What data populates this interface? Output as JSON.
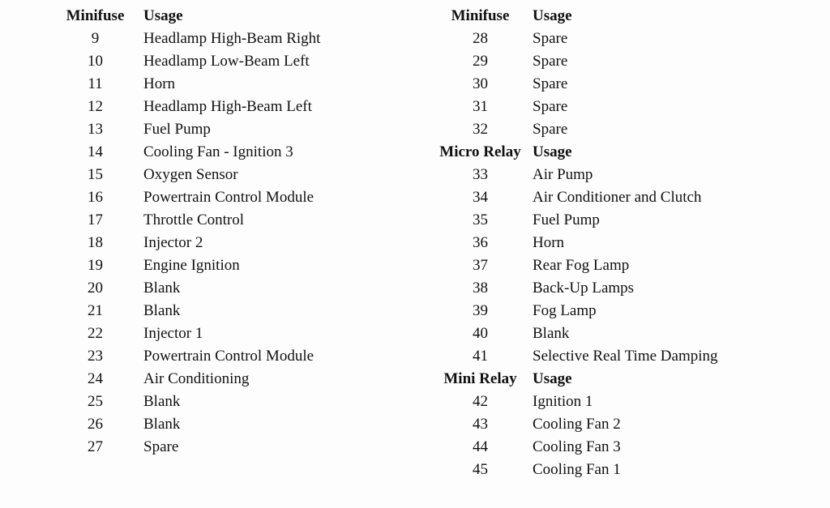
{
  "document": {
    "background_color": "#fdfdfd",
    "text_color": "#111111"
  },
  "columns": [
    {
      "id": "left-column",
      "rows": [
        {
          "type": "header",
          "id": "Minifuse",
          "usage": "Usage"
        },
        {
          "type": "data",
          "id": "9",
          "usage": "Headlamp High-Beam Right"
        },
        {
          "type": "data",
          "id": "10",
          "usage": "Headlamp Low-Beam Left"
        },
        {
          "type": "data",
          "id": "11",
          "usage": "Horn"
        },
        {
          "type": "data",
          "id": "12",
          "usage": "Headlamp High-Beam Left"
        },
        {
          "type": "data",
          "id": "13",
          "usage": "Fuel Pump"
        },
        {
          "type": "data",
          "id": "14",
          "usage": "Cooling Fan - Ignition 3"
        },
        {
          "type": "data",
          "id": "15",
          "usage": "Oxygen Sensor"
        },
        {
          "type": "data",
          "id": "16",
          "usage": "Powertrain Control Module"
        },
        {
          "type": "data",
          "id": "17",
          "usage": "Throttle Control"
        },
        {
          "type": "data",
          "id": "18",
          "usage": "Injector 2"
        },
        {
          "type": "data",
          "id": "19",
          "usage": "Engine Ignition"
        },
        {
          "type": "data",
          "id": "20",
          "usage": "Blank"
        },
        {
          "type": "data",
          "id": "21",
          "usage": "Blank"
        },
        {
          "type": "data",
          "id": "22",
          "usage": "Injector 1"
        },
        {
          "type": "data",
          "id": "23",
          "usage": "Powertrain Control Module"
        },
        {
          "type": "data",
          "id": "24",
          "usage": "Air Conditioning"
        },
        {
          "type": "data",
          "id": "25",
          "usage": "Blank"
        },
        {
          "type": "data",
          "id": "26",
          "usage": "Blank"
        },
        {
          "type": "data",
          "id": "27",
          "usage": "Spare"
        }
      ]
    },
    {
      "id": "right-column",
      "rows": [
        {
          "type": "header",
          "id": "Minifuse",
          "usage": "Usage"
        },
        {
          "type": "data",
          "id": "28",
          "usage": "Spare"
        },
        {
          "type": "data",
          "id": "29",
          "usage": "Spare"
        },
        {
          "type": "data",
          "id": "30",
          "usage": "Spare"
        },
        {
          "type": "data",
          "id": "31",
          "usage": "Spare"
        },
        {
          "type": "data",
          "id": "32",
          "usage": "Spare"
        },
        {
          "type": "section",
          "id": "Micro Relay",
          "usage": "Usage"
        },
        {
          "type": "data",
          "id": "33",
          "usage": "Air Pump"
        },
        {
          "type": "data",
          "id": "34",
          "usage": "Air Conditioner and Clutch"
        },
        {
          "type": "data",
          "id": "35",
          "usage": "Fuel Pump"
        },
        {
          "type": "data",
          "id": "36",
          "usage": "Horn"
        },
        {
          "type": "data",
          "id": "37",
          "usage": "Rear Fog Lamp"
        },
        {
          "type": "data",
          "id": "38",
          "usage": "Back-Up Lamps"
        },
        {
          "type": "data",
          "id": "39",
          "usage": "Fog Lamp"
        },
        {
          "type": "data",
          "id": "40",
          "usage": "Blank"
        },
        {
          "type": "data",
          "id": "41",
          "usage": "Selective Real Time Damping"
        },
        {
          "type": "section",
          "id": "Mini Relay",
          "usage": "Usage"
        },
        {
          "type": "data",
          "id": "42",
          "usage": "Ignition 1"
        },
        {
          "type": "data",
          "id": "43",
          "usage": "Cooling Fan 2"
        },
        {
          "type": "data",
          "id": "44",
          "usage": "Cooling Fan 3"
        },
        {
          "type": "data",
          "id": "45",
          "usage": "Cooling Fan 1"
        }
      ]
    }
  ]
}
